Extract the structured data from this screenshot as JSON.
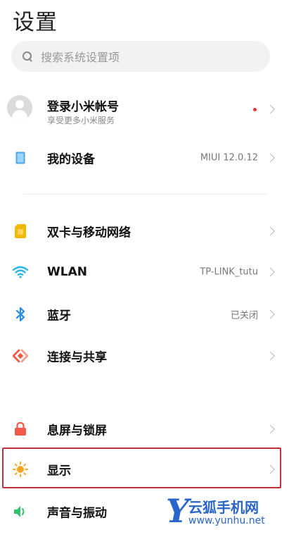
{
  "header": {
    "title": "设置"
  },
  "search": {
    "placeholder": "搜索系统设置项"
  },
  "account": {
    "title": "登录小米帐号",
    "subtitle": "享受更多小米服务"
  },
  "rows": {
    "device": {
      "label": "我的设备",
      "value": "MIUI 12.0.12"
    },
    "sim": {
      "label": "双卡与移动网络"
    },
    "wlan": {
      "label": "WLAN",
      "value": "TP-LINK_tutu"
    },
    "bluetooth": {
      "label": "蓝牙",
      "value": "已关闭"
    },
    "share": {
      "label": "连接与共享"
    },
    "lock": {
      "label": "息屏与锁屏"
    },
    "display": {
      "label": "显示"
    },
    "sound": {
      "label": "声音与振动"
    }
  },
  "watermark": {
    "letter": "Y",
    "brand": "云狐手机网",
    "url": "www.yunhu.net"
  },
  "colors": {
    "highlight": "#c0303a",
    "device": "#4aa8f0",
    "sim": "#f5b800",
    "wlan": "#28b6e8",
    "bluetooth": "#2b8ee8",
    "share": "#ef5a4a",
    "lock": "#ef5a4a",
    "display": "#f5a623",
    "sound": "#34c26b",
    "watermark": "#2a66c9"
  }
}
